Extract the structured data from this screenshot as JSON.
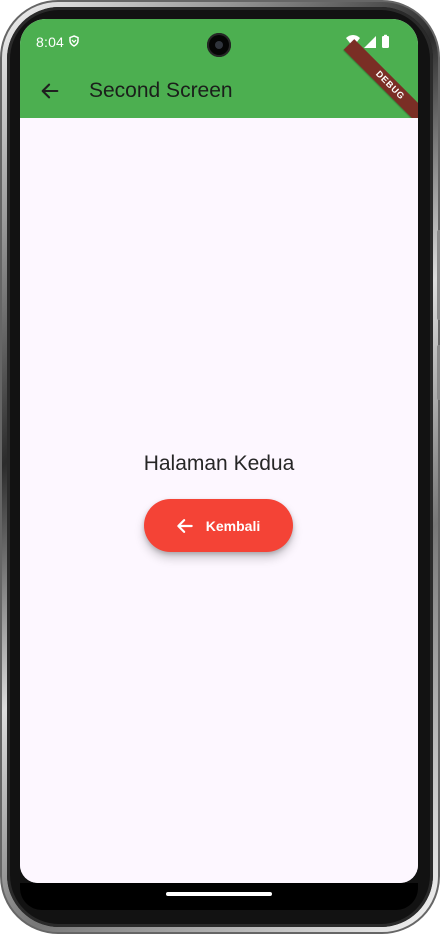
{
  "status_bar": {
    "time": "8:04",
    "icons": [
      "shield-icon",
      "wifi-icon",
      "signal-icon",
      "battery-icon"
    ]
  },
  "app_bar": {
    "title": "Second Screen",
    "back_icon": "arrow-back-icon",
    "debug_label": "DEBUG"
  },
  "main": {
    "heading": "Halaman Kedua",
    "button_label": "Kembali",
    "button_icon": "arrow-back-icon"
  },
  "colors": {
    "app_bar": "#4caf50",
    "background": "#fdf7ff",
    "button": "#f44336",
    "debug_banner": "#7a2e25"
  }
}
